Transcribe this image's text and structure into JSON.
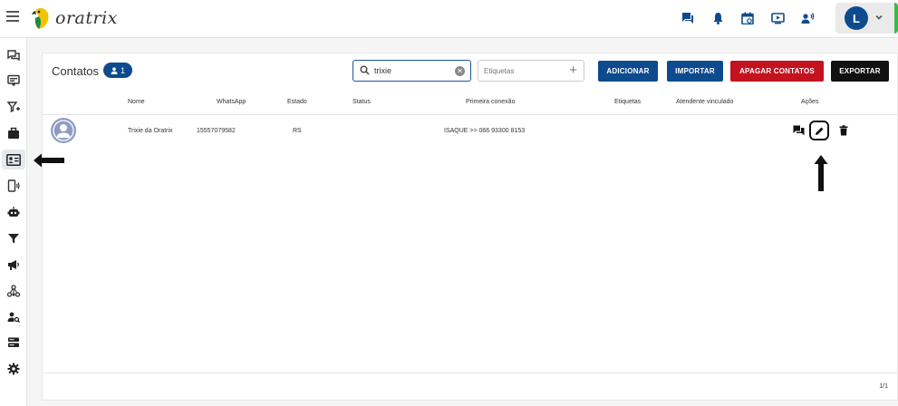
{
  "app": {
    "logo_text": "oratrix"
  },
  "topbar": {
    "icons": [
      "chat-icon",
      "bell-icon",
      "calendar-icon",
      "media-icon",
      "voice-icon"
    ],
    "user_initial": "L"
  },
  "sidebar": {
    "items": [
      {
        "icon": "chats-icon"
      },
      {
        "icon": "monitor-icon"
      },
      {
        "icon": "filter-add-icon"
      },
      {
        "icon": "briefcase-icon"
      },
      {
        "icon": "contacts-card-icon",
        "active": true
      },
      {
        "icon": "phone-signal-icon"
      },
      {
        "icon": "robot-icon"
      },
      {
        "icon": "funnel-icon"
      },
      {
        "icon": "megaphone-icon"
      },
      {
        "icon": "network-icon"
      },
      {
        "icon": "user-search-icon"
      },
      {
        "icon": "storage-icon"
      },
      {
        "icon": "settings-icon"
      }
    ]
  },
  "page": {
    "title": "Contatos",
    "count": "1",
    "search": {
      "value": "trixie",
      "placeholder": ""
    },
    "tags": {
      "placeholder": "Etiquetas"
    },
    "buttons": {
      "add": "ADICIONAR",
      "import": "IMPORTAR",
      "delete": "APAGAR CONTATOS",
      "export": "EXPORTAR"
    }
  },
  "table": {
    "columns": {
      "name": "Nome",
      "whatsapp": "WhatsApp",
      "state": "Estado",
      "status": "Status",
      "first_connection": "Primeira conexão",
      "tags": "Etiquetas",
      "agent": "Atendente vinculado",
      "actions": "Ações"
    },
    "rows": [
      {
        "name": "Trixie da Oratrix",
        "whatsapp": "15557079582",
        "state": "RS",
        "status": "",
        "first_connection": "ISAQUE >> 066 93300 8153",
        "tags": "",
        "agent": ""
      }
    ]
  },
  "pagination": {
    "label": "1/1"
  },
  "colors": {
    "primary": "#0d4b8e",
    "danger": "#c4121f",
    "dark": "#111111",
    "accent_green": "#3cb84a"
  }
}
